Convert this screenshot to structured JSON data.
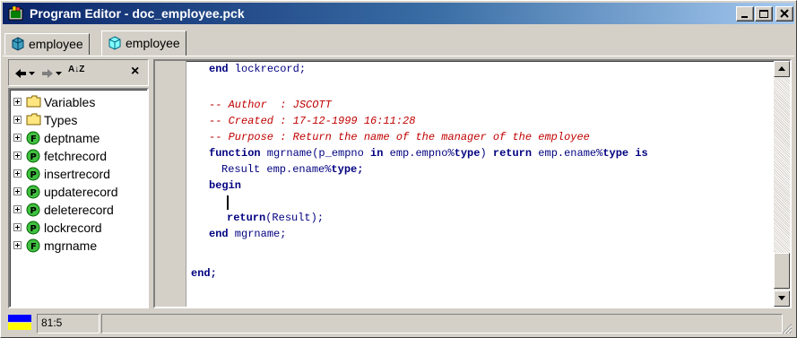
{
  "window": {
    "title": "Program Editor - doc_employee.pck"
  },
  "tabs": [
    {
      "label": "employee",
      "icon": "package-spec-icon",
      "active": false
    },
    {
      "label": "employee",
      "icon": "package-body-icon",
      "active": true
    }
  ],
  "navigator": {
    "close_glyph": "×",
    "sort_glyph": "A↓Z",
    "items": [
      {
        "label": "Variables",
        "icon": "folder-icon"
      },
      {
        "label": "Types",
        "icon": "folder-icon"
      },
      {
        "label": "deptname",
        "icon": "function-icon"
      },
      {
        "label": "fetchrecord",
        "icon": "procedure-icon"
      },
      {
        "label": "insertrecord",
        "icon": "procedure-icon"
      },
      {
        "label": "updaterecord",
        "icon": "procedure-icon"
      },
      {
        "label": "deleterecord",
        "icon": "procedure-icon"
      },
      {
        "label": "lockrecord",
        "icon": "procedure-icon"
      },
      {
        "label": "mgrname",
        "icon": "function-icon"
      }
    ]
  },
  "editor": {
    "lines": {
      "end_lockrecord_kw": "end",
      "end_lockrecord_name": " lockrecord;",
      "comment_author": "-- Author  : JSCOTT",
      "comment_created": "-- Created : 17-12-1999 16:11:28",
      "comment_purpose": "-- Purpose : Return the name of the manager of the employee",
      "fn_kw": "function",
      "fn_sig1": " mgrname(p_empno ",
      "fn_in": "in",
      "fn_sig2": " emp.empno%",
      "fn_type1": "type",
      "fn_sig3": ") ",
      "fn_return": "return",
      "fn_sig4": " emp.ename%",
      "fn_type2": "type",
      "fn_sig5": " ",
      "fn_is": "is",
      "result_decl": "Result emp.ename%",
      "result_type": "type;",
      "begin_kw": "begin",
      "return_kw": "return",
      "return_rest": "(Result);",
      "end_mgrname_kw": "end",
      "end_mgrname_name": " mgrname;",
      "end_pkg_kw": "end;"
    }
  },
  "status": {
    "cursor_position": "81:5"
  },
  "colors": {
    "titlebar": "#0a246a",
    "keyword": "#000080",
    "comment": "#c00000"
  }
}
